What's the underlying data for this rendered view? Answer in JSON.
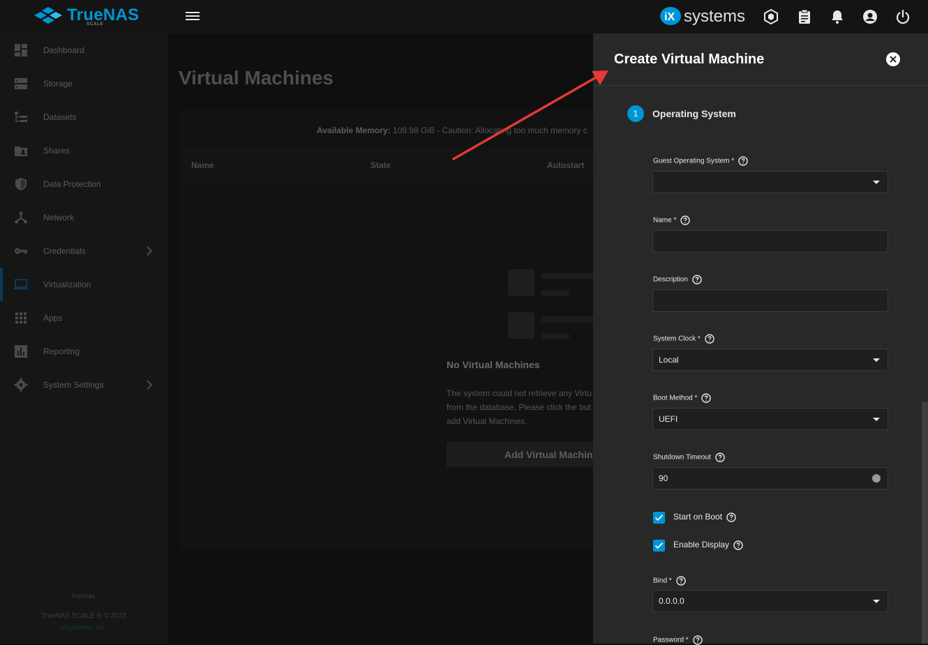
{
  "topbar": {
    "brand_name": "TrueNAS",
    "brand_edition": "SCALE",
    "vendor_name": "systems",
    "vendor_prefix": "iX"
  },
  "sidebar": {
    "items": [
      {
        "label": "Dashboard",
        "icon": "dashboard-icon"
      },
      {
        "label": "Storage",
        "icon": "storage-icon"
      },
      {
        "label": "Datasets",
        "icon": "datasets-icon"
      },
      {
        "label": "Shares",
        "icon": "shares-icon"
      },
      {
        "label": "Data Protection",
        "icon": "shield-icon"
      },
      {
        "label": "Network",
        "icon": "network-icon"
      },
      {
        "label": "Credentials",
        "icon": "key-icon"
      },
      {
        "label": "Virtualization",
        "icon": "laptop-icon"
      },
      {
        "label": "Apps",
        "icon": "apps-grid-icon"
      },
      {
        "label": "Reporting",
        "icon": "bar-chart-icon"
      },
      {
        "label": "System Settings",
        "icon": "gear-icon"
      }
    ],
    "active": "Virtualization",
    "footer_host": "truenas",
    "footer_copyright": "TrueNAS SCALE ® © 2023",
    "footer_link": "iXsystems, Inc."
  },
  "main": {
    "title": "Virtual Machines",
    "memory_label": "Available Memory:",
    "memory_text": " 109.98 GiB - Caution: Allocating too much memory c",
    "columns": [
      "Name",
      "State",
      "Autostart"
    ],
    "empty_title": "No Virtual Machines",
    "empty_desc_1": "The system could not retrieve any Virtu",
    "empty_desc_2": "from the database. Please click the but",
    "empty_desc_3": "add Virtual Machines.",
    "add_button": "Add Virtual Machine"
  },
  "panel": {
    "title": "Create Virtual Machine",
    "step_number": "1",
    "step_label": "Operating System",
    "fields": {
      "guest_os": {
        "label": "Guest Operating System *",
        "value": ""
      },
      "name": {
        "label": "Name *",
        "value": ""
      },
      "description": {
        "label": "Description",
        "value": ""
      },
      "system_clock": {
        "label": "System Clock *",
        "value": "Local"
      },
      "boot_method": {
        "label": "Boot Method *",
        "value": "UEFI"
      },
      "shutdown_timeout": {
        "label": "Shutdown Timeout",
        "value": "90"
      },
      "start_on_boot": {
        "label": "Start on Boot",
        "checked": true
      },
      "enable_display": {
        "label": "Enable Display",
        "checked": true
      },
      "bind": {
        "label": "Bind *",
        "value": "0.0.0.0"
      },
      "password": {
        "label": "Password *"
      }
    }
  },
  "colors": {
    "accent": "#0095d5",
    "panel_bg": "#282828",
    "annotation_arrow": "#e53935"
  }
}
